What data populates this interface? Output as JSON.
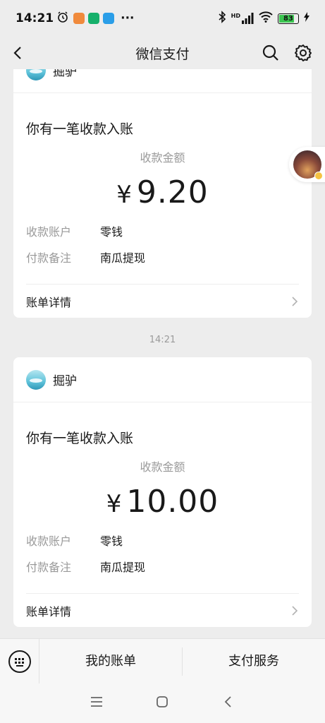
{
  "status": {
    "time": "14:21",
    "more": "···",
    "network": "HD",
    "battery": "83",
    "battery_level": 0.83
  },
  "nav": {
    "title": "微信支付"
  },
  "cards": [
    {
      "merchant": "掘驴",
      "headline": "你有一笔收款入账",
      "amount_label": "收款金额",
      "currency": "¥",
      "amount": "9.20",
      "rows": [
        {
          "key": "收款账户",
          "value": "零钱"
        },
        {
          "key": "付款备注",
          "value": "南瓜提现"
        }
      ],
      "detail": "账单详情"
    },
    {
      "merchant": "掘驴",
      "headline": "你有一笔收款入账",
      "amount_label": "收款金额",
      "currency": "¥",
      "amount": "10.00",
      "rows": [
        {
          "key": "收款账户",
          "value": "零钱"
        },
        {
          "key": "付款备注",
          "value": "南瓜提现"
        }
      ],
      "detail": "账单详情"
    }
  ],
  "timestamp": "14:21",
  "menu": {
    "bills": "我的账单",
    "services": "支付服务"
  },
  "colors": {
    "background": "#ededed",
    "card": "#ffffff",
    "muted_text": "#9a9a9a",
    "battery": "#3cc651"
  }
}
